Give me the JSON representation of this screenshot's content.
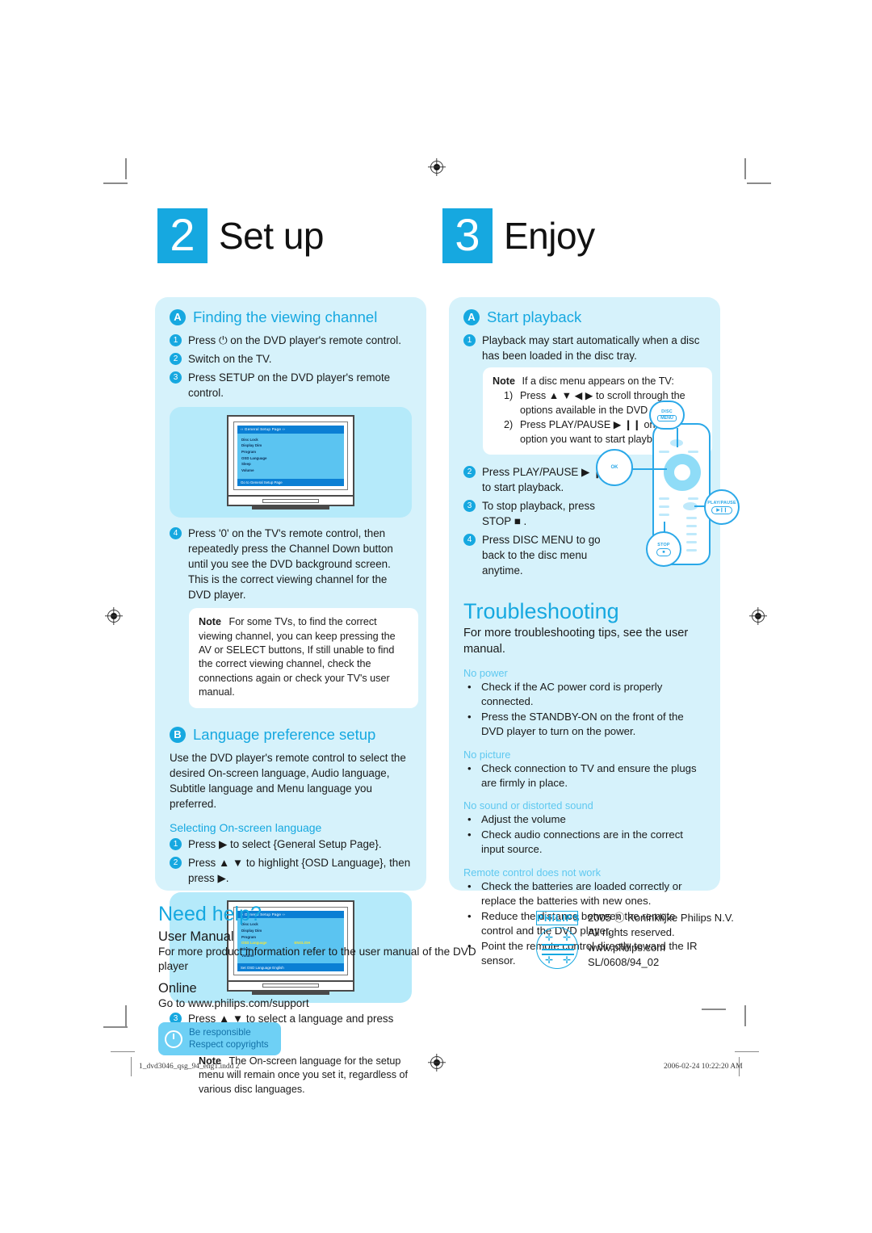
{
  "steps": {
    "setup": {
      "number": "2",
      "title": "Set up"
    },
    "enjoy": {
      "number": "3",
      "title": "Enjoy"
    }
  },
  "section_a_left": {
    "badge": "A",
    "title": "Finding the viewing channel",
    "steps": [
      "Press ⏻ on the DVD player's remote control.",
      "Switch on the TV.",
      "Press SETUP on the DVD player's remote control.",
      "Press '0' on the TV's remote control, then repeatedly press the Channel Down button until you see the DVD background screen. This is the correct viewing channel for the DVD player."
    ],
    "note_label": "Note",
    "note_text": "For some TVs, to find the correct viewing channel, you can keep pressing the AV or SELECT buttons, If still unable to find the correct viewing channel, check the connections again or check your TV's user manual."
  },
  "tv_osd_1": {
    "title": "‹‹ General Setup Page ››",
    "items": [
      "Disc Lock",
      "Display Dim",
      "Program",
      "OSD Language",
      "Sleep",
      "Volume"
    ],
    "footer": "Go to General Setup Page"
  },
  "tv_osd_2": {
    "title": "‹‹ General Setup Page ››",
    "items": [
      "Disc Lock",
      "Display Dim",
      "Program",
      "OSD Language",
      "Sleep",
      "Volume"
    ],
    "highlight_index": 3,
    "highlight_value": "ENGLISH",
    "footer": "Set OSD Language English"
  },
  "section_b_left": {
    "badge": "B",
    "title": "Language preference setup",
    "intro": "Use the DVD player's remote control to select the desired On-screen language, Audio language, Subtitle language and Menu language you preferred.",
    "subheading": "Selecting On-screen language",
    "steps": [
      "Press ▶ to select {General Setup Page}.",
      "Press ▲ ▼ to highlight {OSD Language}, then press ▶.",
      "Press ▲ ▼ to select a language and press OK."
    ],
    "note_label": "Note",
    "note_text": "The On-screen language for the setup menu will remain once you set it, regardless of various disc languages."
  },
  "section_a_right": {
    "badge": "A",
    "title": "Start playback",
    "step1": "Playback may start automatically when a disc has been loaded in the disc tray.",
    "note_label": "Note",
    "note_intro": "If a disc menu appears on the TV:",
    "note_subs": [
      {
        "label": "1)",
        "text": "Press ▲ ▼ ◀ ▶ to scroll through the options available in the DVD menu."
      },
      {
        "label": "2)",
        "text": "Press PLAY/PAUSE ▶ ❙❙ on the option you want to start playback"
      }
    ],
    "steps_rest": [
      "Press PLAY/PAUSE ▶ ❙❙ to start playback.",
      "To stop playback, press STOP ■ .",
      "Press DISC MENU to go back to the disc menu anytime."
    ]
  },
  "remote": {
    "callout_disc_line1": "DISC",
    "callout_disc_line2": "MENU",
    "callout_play": "PLAY/PAUSE",
    "callout_play_glyph": "▶❙❙",
    "callout_stop": "STOP",
    "callout_stop_glyph": "■",
    "callout_ok": "OK"
  },
  "troubleshooting": {
    "title": "Troubleshooting",
    "subtitle": "For more troubleshooting tips, see the user manual.",
    "categories": [
      {
        "name": "No power",
        "items": [
          "Check if the AC power cord is properly connected.",
          "Press the STANDBY-ON on the front of the DVD player to turn on the power."
        ]
      },
      {
        "name": "No picture",
        "items": [
          "Check connection to TV and ensure the plugs are firmly in place."
        ]
      },
      {
        "name": "No sound or distorted sound",
        "items": [
          "Adjust the volume",
          "Check audio connections are in the correct input source."
        ]
      },
      {
        "name": "Remote control does not work",
        "items": [
          "Check the batteries are loaded correctly or replace the batteries with new ones.",
          "Reduce the distance between the remote control and the DVD player.",
          "Point the remote control directly toward the IR sensor."
        ]
      }
    ]
  },
  "need_help": {
    "title": "Need help?",
    "manual_heading": "User Manual",
    "manual_text": "For more product information refer to the user manual of the DVD player",
    "online_heading": "Online",
    "online_text": "Go to www.philips.com/support",
    "badge_line1": "Be responsible",
    "badge_line2": "Respect copyrights"
  },
  "philips": {
    "wordmark": "PHILIPS",
    "line1": "2005 ⓒ Koninklijke Philips N.V.",
    "line2": "All rights reserved.",
    "line3": "www.philips.com",
    "line4": "SL/0608/94_02"
  },
  "footer": {
    "filename": "1_dvd3046_qsg_94_eng1.indd   2",
    "timestamp": "2006-02-24   10:22:20 AM"
  },
  "colors": {
    "accent": "#16a8e0",
    "panel": "#d6f2fb",
    "panel_dark": "#b5eafa",
    "osd_blue": "#5bc4f1",
    "osd_bar": "#0b7fd4",
    "highlight": "#f2e53c"
  }
}
